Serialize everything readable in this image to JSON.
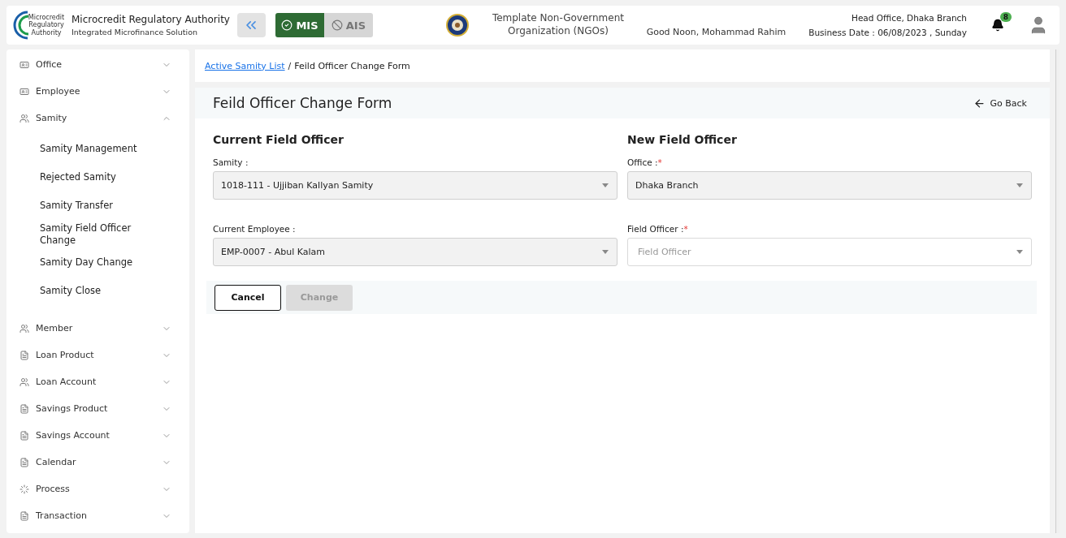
{
  "header": {
    "org_title": "Microcredit Regulatory Authority",
    "org_subtitle": "Integrated Microfinance Solution",
    "logo_text": "Microcredit Regulatory Authority",
    "modules": [
      {
        "label": "MIS",
        "selected": true
      },
      {
        "label": "AIS",
        "selected": false
      }
    ],
    "ngo_name": "Template Non-Government Organization (NGOs)",
    "greeting": "Good Noon, Mohammad Rahim",
    "office": "Head Office, Dhaka Branch",
    "business_date": "Business Date : 06/08/2023 , Sunday",
    "notification_count": "8"
  },
  "sidebar": {
    "items": [
      {
        "label": "Office",
        "expanded": false
      },
      {
        "label": "Employee",
        "expanded": false
      },
      {
        "label": "Samity",
        "expanded": true,
        "children": [
          {
            "label": "Samity Management"
          },
          {
            "label": "Rejected Samity"
          },
          {
            "label": "Samity Transfer"
          },
          {
            "label": "Samity Field Officer Change"
          },
          {
            "label": "Samity Day Change"
          },
          {
            "label": "Samity Close"
          }
        ]
      },
      {
        "label": "Member",
        "expanded": false
      },
      {
        "label": "Loan Product",
        "expanded": false
      },
      {
        "label": "Loan Account",
        "expanded": false
      },
      {
        "label": "Savings Product",
        "expanded": false
      },
      {
        "label": "Savings Account",
        "expanded": false
      },
      {
        "label": "Calendar",
        "expanded": false
      },
      {
        "label": "Process",
        "expanded": false
      },
      {
        "label": "Transaction",
        "expanded": false
      }
    ]
  },
  "breadcrumb": {
    "link": "Active Samity List",
    "separator": "/",
    "current": "Feild Officer Change Form"
  },
  "form": {
    "title": "Feild Officer Change Form",
    "go_back": "Go Back",
    "required_mark": "*",
    "sections": [
      {
        "heading": "Current Field Officer",
        "fields": [
          {
            "label": "Samity :",
            "required": false,
            "disabled": true,
            "value": "1018-111 - Ujjiban Kallyan Samity"
          },
          {
            "label": "Current Employee :",
            "required": false,
            "disabled": true,
            "value": "EMP-0007 - Abul Kalam"
          }
        ]
      },
      {
        "heading": "New Field Officer",
        "fields": [
          {
            "label": "Office :",
            "required": true,
            "disabled": true,
            "value": "Dhaka Branch"
          },
          {
            "label": "Field Officer :",
            "required": true,
            "disabled": false,
            "placeholder": "Field Officer"
          }
        ]
      }
    ],
    "buttons": [
      {
        "label": "Cancel",
        "disabled": false
      },
      {
        "label": "Change",
        "disabled": true
      }
    ]
  }
}
